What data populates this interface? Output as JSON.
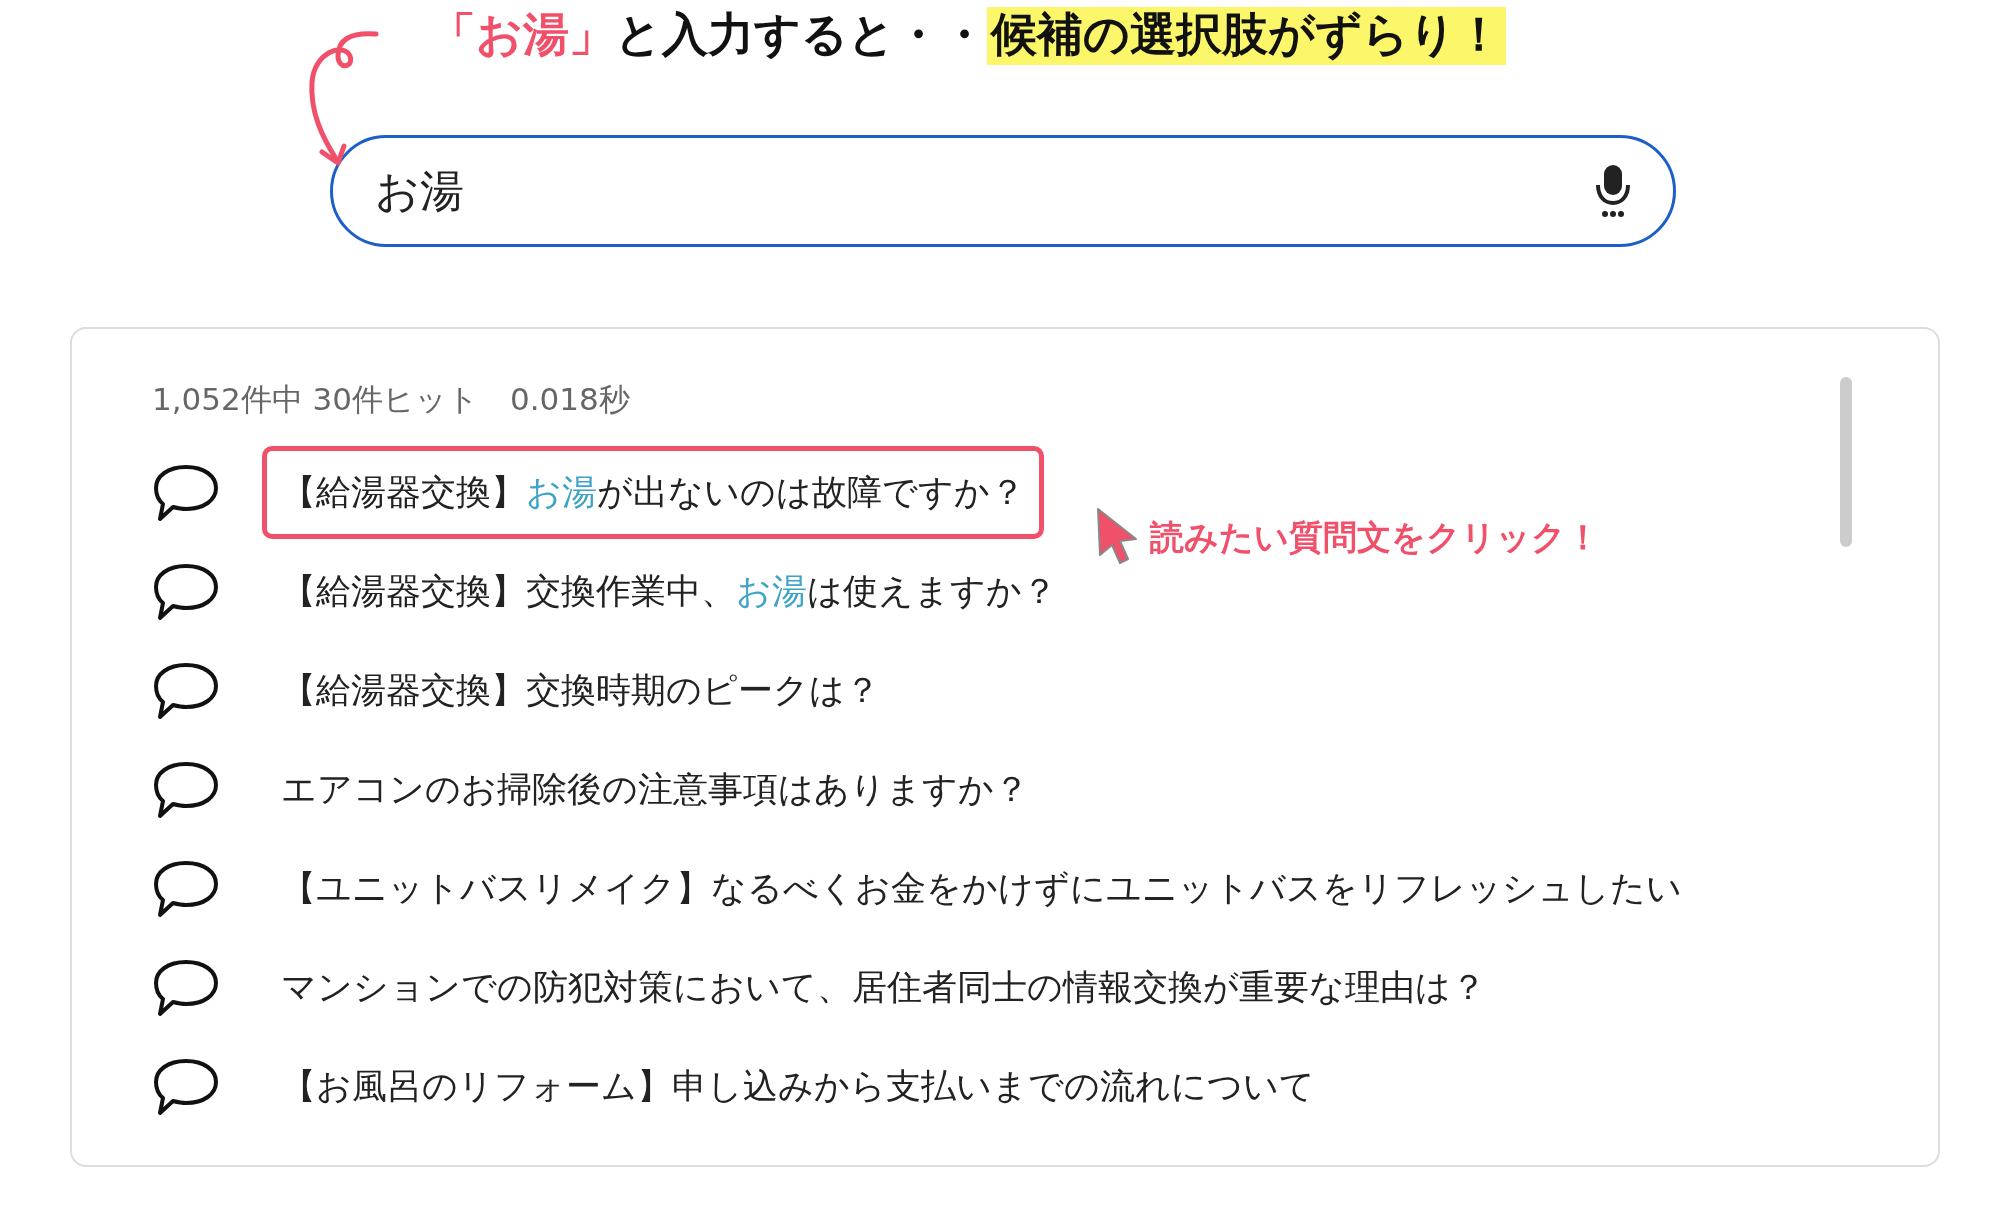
{
  "annotation": {
    "quote": "「お湯」",
    "middle": "と入力すると・・",
    "emphasis": "候補の選択肢がずらり！"
  },
  "search": {
    "value": "お湯"
  },
  "results": {
    "summary": "1,052件中 30件ヒット　0.018秒",
    "items": [
      {
        "selected": true,
        "segments": [
          {
            "text": "【給湯器交換】",
            "highlight": false
          },
          {
            "text": "お湯",
            "highlight": true
          },
          {
            "text": "が出ないのは故障ですか？",
            "highlight": false
          }
        ]
      },
      {
        "selected": false,
        "segments": [
          {
            "text": "【給湯器交換】交換作業中、",
            "highlight": false
          },
          {
            "text": "お湯",
            "highlight": true
          },
          {
            "text": "は使えますか？",
            "highlight": false
          }
        ]
      },
      {
        "selected": false,
        "segments": [
          {
            "text": "【給湯器交換】交換時期のピークは？",
            "highlight": false
          }
        ]
      },
      {
        "selected": false,
        "segments": [
          {
            "text": "エアコンのお掃除後の注意事項はありますか？",
            "highlight": false
          }
        ]
      },
      {
        "selected": false,
        "segments": [
          {
            "text": "【ユニットバスリメイク】なるべくお金をかけずにユニットバスをリフレッシュしたい",
            "highlight": false
          }
        ]
      },
      {
        "selected": false,
        "segments": [
          {
            "text": "マンションでの防犯対策において、居住者同士の情報交換が重要な理由は？",
            "highlight": false
          }
        ]
      },
      {
        "selected": false,
        "segments": [
          {
            "text": "【お風呂のリフォーム】申し込みから支払いまでの流れについて",
            "highlight": false
          }
        ]
      }
    ]
  },
  "callout": {
    "text": "読みたい質問文をクリック！"
  }
}
